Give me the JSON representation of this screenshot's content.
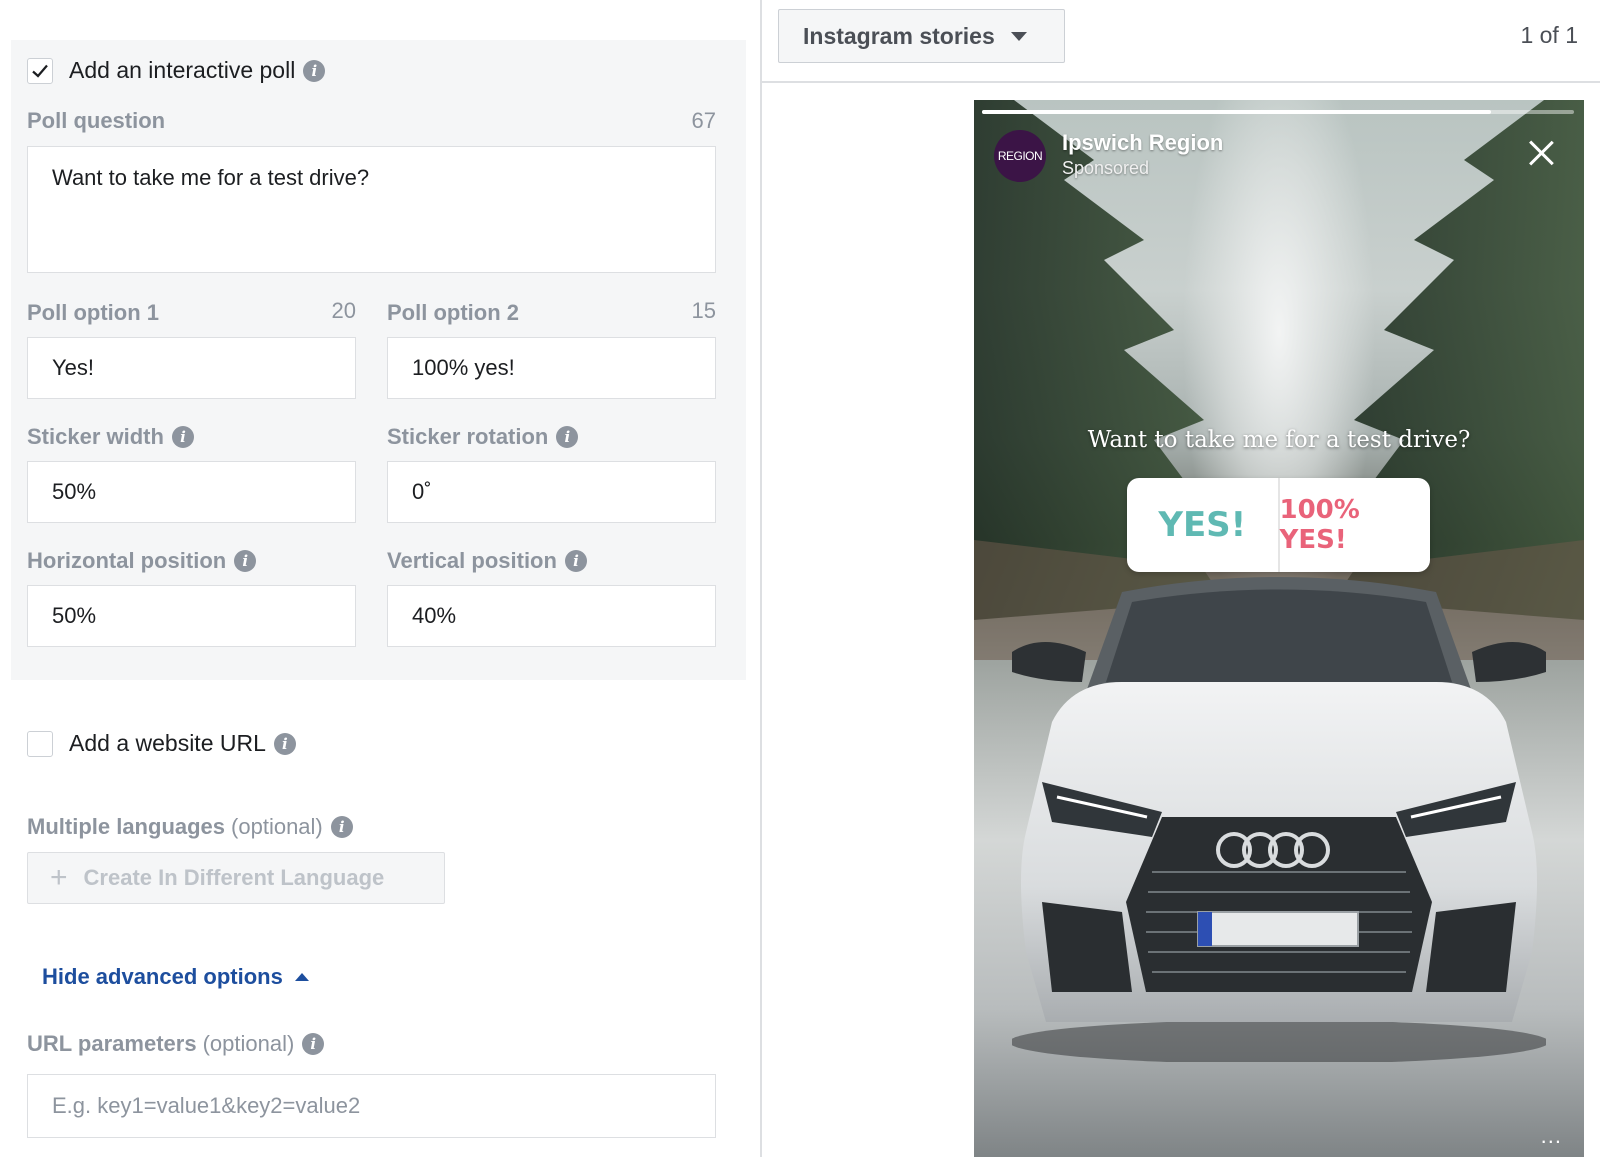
{
  "poll": {
    "checkbox_label": "Add an interactive poll",
    "checked": true,
    "question_label": "Poll question",
    "question_count": "67",
    "question_value": "Want to take me for a test drive?",
    "option1_label": "Poll option 1",
    "option1_count": "20",
    "option1_value": "Yes!",
    "option2_label": "Poll option 2",
    "option2_count": "15",
    "option2_value": "100% yes!",
    "sticker_width_label": "Sticker width",
    "sticker_width_value": "50%",
    "sticker_rotation_label": "Sticker rotation",
    "sticker_rotation_value": "0˚",
    "horizontal_label": "Horizontal position",
    "horizontal_value": "50%",
    "vertical_label": "Vertical position",
    "vertical_value": "40%"
  },
  "website_url": {
    "checkbox_label": "Add a website URL",
    "checked": false
  },
  "languages": {
    "label": "Multiple languages",
    "optional": "(optional)",
    "button_label": "Create In Different Language"
  },
  "advanced": {
    "toggle_label": "Hide advanced options",
    "url_params_label": "URL parameters",
    "url_params_optional": "(optional)",
    "url_params_placeholder": "E.g. key1=value1&key2=value2"
  },
  "preview": {
    "placement": "Instagram stories",
    "pager": "1 of 1",
    "story_progress": 0.86,
    "brand_name": "Ipswich Region",
    "avatar_text": "REGION",
    "sponsored": "Sponsored",
    "poll_question": "Want to take me for a test drive?",
    "sticker_option1": "YES!",
    "sticker_option2": "100% YES!",
    "more_menu": "..."
  },
  "colors": {
    "link_blue": "#1d4e9e",
    "label_gray": "#8d949e",
    "panel_bg": "#f5f6f7"
  }
}
